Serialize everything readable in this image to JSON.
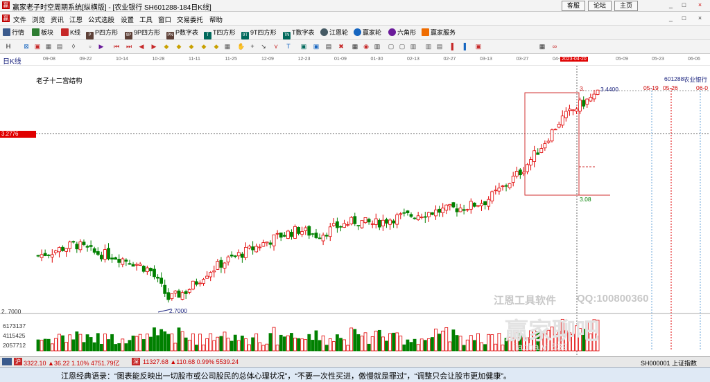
{
  "window": {
    "title": "赢家老子时空周期系统[纵横版] - [农业银行  SH601288-184日K线]",
    "app_icon": "赢"
  },
  "top_links": [
    "客服",
    "论坛",
    "主页"
  ],
  "window_controls": [
    "_",
    "□",
    "×"
  ],
  "menu": [
    "文件",
    "浏览",
    "资讯",
    "江恩",
    "公式选股",
    "设置",
    "工具",
    "窗口",
    "交易委托",
    "帮助"
  ],
  "mdi_controls": [
    "_",
    "□",
    "×"
  ],
  "toolbar": [
    {
      "icon": "grid-icon",
      "label": "行情"
    },
    {
      "icon": "blocks-icon",
      "label": "板块"
    },
    {
      "icon": "kline-icon",
      "label": "K线"
    },
    {
      "icon": "p-square-icon",
      "badge": "P",
      "label": "P四方形"
    },
    {
      "icon": "9p-square-icon",
      "badge": "9P",
      "label": "9P四方形"
    },
    {
      "icon": "pn-icon",
      "badge": "PN",
      "label": "P数字表"
    },
    {
      "icon": "t-square-icon",
      "badge": "T",
      "label": "T四方形"
    },
    {
      "icon": "9t-square-icon",
      "badge": "9T",
      "label": "9T四方形"
    },
    {
      "icon": "tn-icon",
      "badge": "TN",
      "label": "T数字表"
    },
    {
      "icon": "gann-wheel-icon",
      "label": "江恩轮"
    },
    {
      "icon": "winner-wheel-icon",
      "label": "赢家轮"
    },
    {
      "icon": "hexagon-icon",
      "label": "六角形"
    },
    {
      "icon": "service-icon",
      "label": "赢家服务"
    }
  ],
  "chart": {
    "period_label": "日K线",
    "indicator_title": "老子十二宫结构",
    "stock_code": "601288",
    "stock_name": "农业银行",
    "date_axis": [
      "09-08",
      "09-22",
      "10-14",
      "10-28",
      "11-11",
      "11-25",
      "12-09",
      "12-23",
      "01-09",
      "01-30",
      "02-13",
      "02-27",
      "03-13",
      "03-27",
      "04-11",
      "2023-04-20",
      "05-09",
      "05-23",
      "06-06"
    ],
    "current_price_label": "3.2776",
    "high_label": "3.4400",
    "high_prefix": "3.",
    "box_low_label": "3.08",
    "low_left_label": "2.7000",
    "axis_low_label": "2. 7000",
    "future_dates": [
      "05-19",
      "05-26",
      "06-0"
    ],
    "volume_axis": [
      "6173137",
      "4115425",
      "2057712"
    ],
    "watermark_1": "江恩工具软件",
    "watermark_2": "QQ:100800360",
    "watermark_3": "赢家聊吧",
    "watermark_4": "jiaoba.yj 539"
  },
  "status": {
    "sh_badge": "沪",
    "sh_quote": "3322.10 ▲36.22 1.10% 4751.79亿",
    "sz_badge": "深",
    "sz_quote": "11327.68 ▲110.68 0.99% 5539.24",
    "index_label": "SH000001 上证指数"
  },
  "quote": "江恩经典语录：“图表能反映出一切股市或公司股民的总体心理状况”，“不要一次性买进，傲慢就是罪过”，“调整只会让股市更加健康”。",
  "colors": {
    "up": "#e00000",
    "down": "#008000",
    "accent": "#1a237e",
    "price_tag": "#e00000"
  },
  "chart_data": {
    "type": "candlestick",
    "stock": "601288 农业银行",
    "period": "daily",
    "price_labels": {
      "current": 3.2776,
      "high": 3.44,
      "box_low": 3.08,
      "low": 2.7
    },
    "close_trend": [
      2.86,
      2.88,
      2.9,
      2.87,
      2.86,
      2.84,
      2.81,
      2.71,
      2.74,
      2.8,
      2.84,
      2.87,
      2.9,
      2.93,
      2.95,
      2.93,
      2.96,
      2.98,
      2.97,
      2.99,
      3.0,
      3.01,
      3.02,
      3.03,
      3.05,
      3.1,
      3.16,
      3.24,
      3.33,
      3.38,
      3.42
    ]
  }
}
